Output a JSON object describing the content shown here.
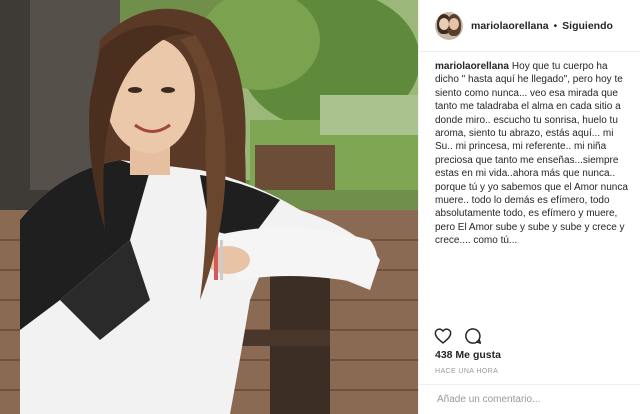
{
  "header": {
    "username": "mariolaorellana",
    "separator": "•",
    "follow_label": "Siguiendo"
  },
  "caption": {
    "username": "mariolaorellana",
    "text": "Hoy que tu cuerpo ha dicho \" hasta aquí he llegado\", pero hoy te siento como nunca... veo esa mirada que tanto me taladraba el alma en cada sitio a donde miro.. escucho tu sonrisa, huelo tu aroma, siento tu abrazo, estás aquí... mi Su.. mi princesa, mi referente.. mi niña preciosa que tanto me enseñas...siempre estas en mi vida..ahora más que nunca.. porque tú y yo sabemos que el Amor nunca muere.. todo lo demás es efímero, todo absolutamente todo, es efímero y muere, pero El Amor sube y sube y sube y crece y crece.... como tú..."
  },
  "actions": {
    "like_icon": "heart-icon",
    "comment_icon": "comment-icon"
  },
  "likes_text": "438 Me gusta",
  "timestamp": "HACE UNA HORA",
  "comment": {
    "placeholder": "Añade un comentario..."
  },
  "colors": {
    "text": "#262626",
    "muted": "#999999",
    "border": "#efefef"
  }
}
